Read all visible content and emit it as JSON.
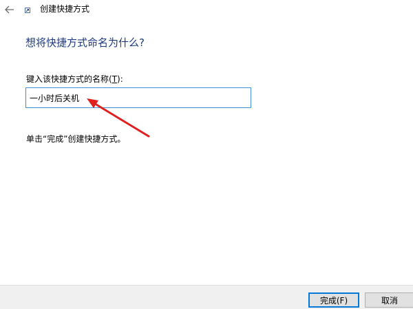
{
  "window": {
    "title": "创建快捷方式"
  },
  "page": {
    "heading": "想将快捷方式命名为什么?",
    "field_label": "键入该快捷方式的名称(",
    "field_label_accel": "T",
    "field_label_suffix": "):",
    "name_value": "一小时后关机",
    "hint": "单击“完成”创建快捷方式。"
  },
  "footer": {
    "finish_label": "完成(F)",
    "cancel_label": "取消"
  },
  "icons": {
    "back": "back-arrow-icon",
    "wizard": "shortcut-wizard-icon"
  },
  "colors": {
    "heading": "#1d3a80",
    "input_border": "#3d8fd6",
    "annotation_arrow": "#e0201f",
    "default_button_border": "#0078d7"
  }
}
